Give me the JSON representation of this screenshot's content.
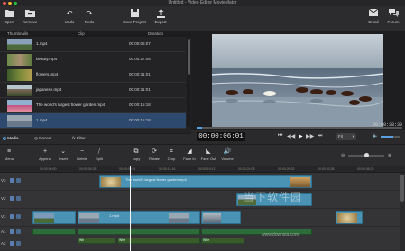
{
  "window": {
    "title": "Untitled - Video Editor MovieMator"
  },
  "toolbar": {
    "open": "Open",
    "remove": "Remove",
    "undo": "Undo",
    "redo": "Redo",
    "save_project": "Save Project",
    "export": "Export",
    "email": "Email",
    "forum": "Forum"
  },
  "media": {
    "columns": {
      "thumbnails": "Thumbnails",
      "clip": "Clip",
      "duration": "Duration"
    },
    "rows": [
      {
        "clip": "1.mp4",
        "duration": "00:00:05:07"
      },
      {
        "clip": "beauty.mp4",
        "duration": "00:00:27:06"
      },
      {
        "clip": "flowers.mp4",
        "duration": "00:00:31:01"
      },
      {
        "clip": "japanese.mp4",
        "duration": "00:00:31:01"
      },
      {
        "clip": "The world's largest flower garden.mp4",
        "duration": "00:00:15:18"
      },
      {
        "clip": "1.mp4",
        "duration": "00:00:15:18"
      }
    ],
    "tabs": {
      "media": "Media",
      "recent": "Recent",
      "filter": "Filter"
    }
  },
  "preview": {
    "current_time": "00:00:06:01",
    "total_time": "00:00:38:39",
    "fit": "Fit"
  },
  "timeline_toolbar": {
    "menu": "Menu",
    "append": "Append",
    "insert": "Insert",
    "delete": "Delete",
    "split": "Split",
    "copy": "copy",
    "rotate": "Rotate",
    "crop": "Crop",
    "fade_in": "Fade In",
    "fade_out": "Fade Out",
    "volume": "Volume"
  },
  "ruler": {
    "ticks": [
      "00:00:00:00",
      "00:00:04:25",
      "00:00:09:21",
      "00:00:14:16",
      "00:00:19:12",
      "00:00:24:08",
      "00:00:29:02",
      "00:00:33:28",
      "00:00:38:23"
    ]
  },
  "tracks": {
    "labels": [
      "V3",
      "V2",
      "V1",
      "A1",
      "A2"
    ],
    "v2_clip": "The world's largest flower garden.mp4",
    "v1_clip": "1.mp4",
    "a_clip_1": "Wh",
    "a_clip_2": "Whe",
    "a_clip_3": "Whe"
  },
  "watermark": {
    "text": "当下软件园",
    "url": "www.downxia.com"
  }
}
